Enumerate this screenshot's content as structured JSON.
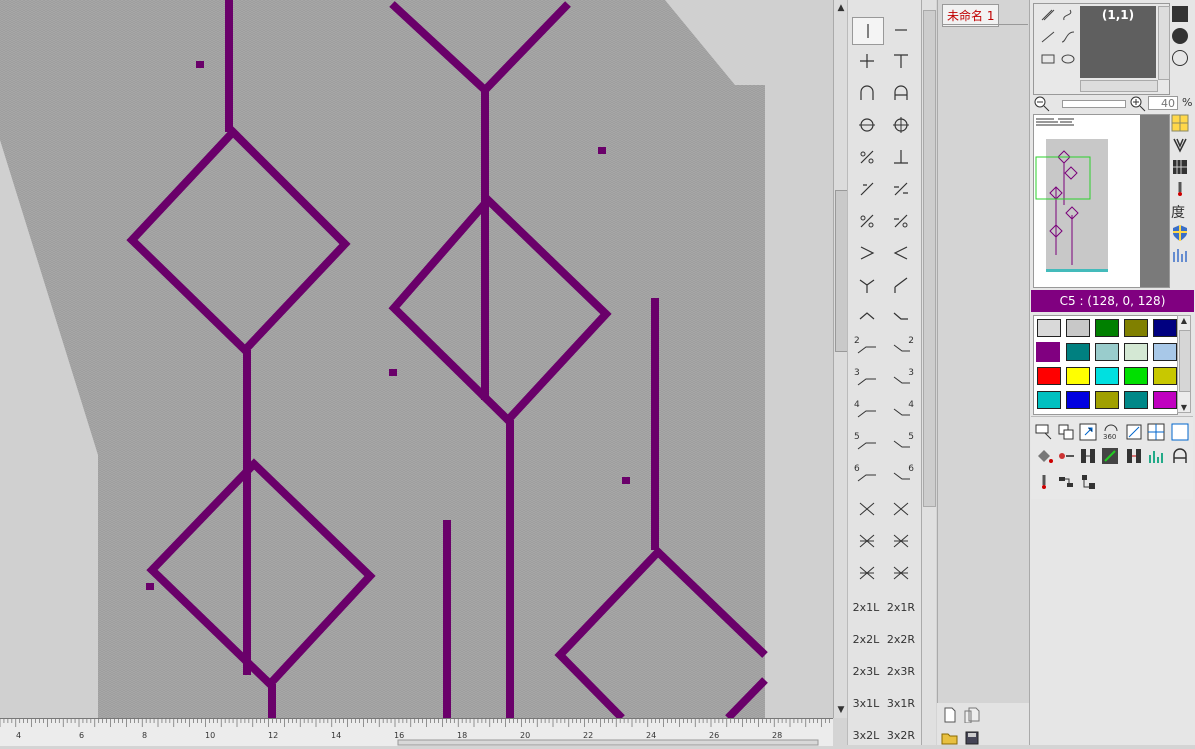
{
  "file_tab": "未命名 1",
  "coord_display": "(1,1)",
  "zoom_value": "40",
  "zoom_unit": "%",
  "color_banner": "C5 : (128, 0, 128)",
  "side_icon_label": "度",
  "ruler_labels": [
    "4",
    "6",
    "8",
    "10",
    "12",
    "14",
    "16",
    "18",
    "20",
    "22",
    "24",
    "26",
    "28"
  ],
  "stitch_text_buttons": [
    "2x1L",
    "2x1R",
    "2x2L",
    "2x2R",
    "2x3L",
    "2x3R",
    "3x1L",
    "3x1R",
    "3x2L",
    "3x2R"
  ],
  "stitch_number_labels": [
    "2",
    "2",
    "3",
    "3",
    "4",
    "4",
    "5",
    "5",
    "6",
    "6"
  ],
  "palette": [
    "#d9d9d9",
    "#c8c8c8",
    "#008000",
    "#808000",
    "#000080",
    "#800080",
    "#008080",
    "#99cccc",
    "#d4e8d4",
    "#a8c8e8",
    "#ff0000",
    "#ffff00",
    "#00e0e0",
    "#00e000",
    "#c8c800",
    "#00c0c0",
    "#0000e0",
    "#a0a000",
    "#008888",
    "#c000c0"
  ],
  "colors": {
    "knit_bg": "#a8a8a8",
    "motif": "#6a006a",
    "banner": "#800080",
    "file_tab_text": "#c00000"
  }
}
